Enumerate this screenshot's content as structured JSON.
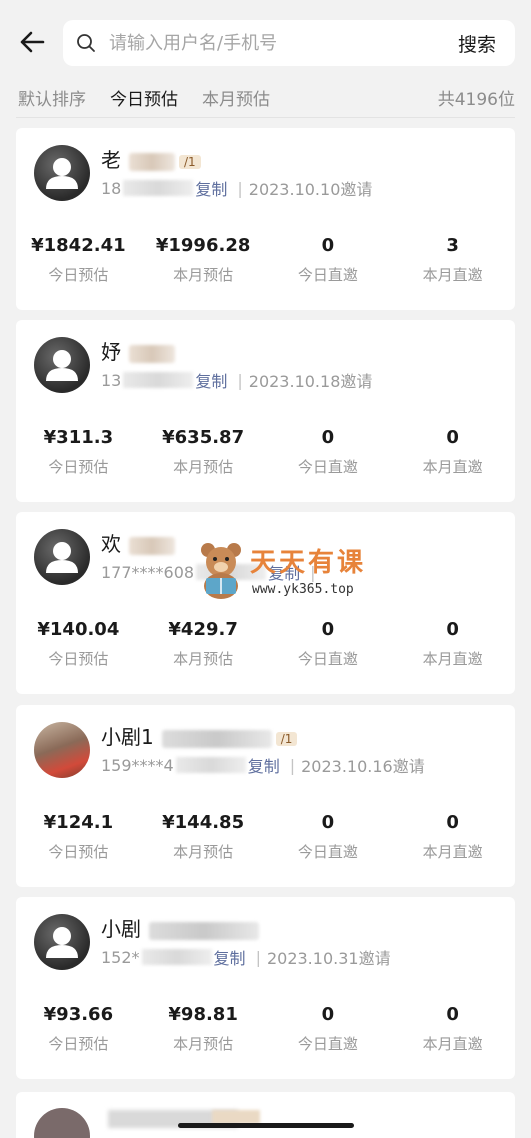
{
  "header": {
    "back_icon": "arrow-left-icon",
    "search_icon": "search-icon",
    "search_placeholder": "请输入用户名/手机号",
    "search_button": "搜索"
  },
  "sort": {
    "tabs": [
      "默认排序",
      "今日预估",
      "本月预估"
    ],
    "active_index": 1,
    "total": "共4196位"
  },
  "stat_labels": [
    "今日预估",
    "本月预估",
    "今日直邀",
    "本月直邀"
  ],
  "copy_label": "复制",
  "separator": "|",
  "members": [
    {
      "name": "老",
      "tag": "/1",
      "phone_prefix": "18",
      "phone_suffix": "",
      "invite": "2023.10.10邀请",
      "today_est": "¥1842.41",
      "month_est": "¥1996.28",
      "today_invites": "0",
      "month_invites": "3"
    },
    {
      "name": "妤",
      "tag": "",
      "phone_prefix": "13",
      "phone_suffix": "",
      "invite": "2023.10.18邀请",
      "today_est": "¥311.3",
      "month_est": "¥635.87",
      "today_invites": "0",
      "month_invites": "0"
    },
    {
      "name": "欢",
      "tag": "",
      "phone_prefix": "177****608",
      "phone_suffix": "",
      "invite": "",
      "today_est": "¥140.04",
      "month_est": "¥429.7",
      "today_invites": "0",
      "month_invites": "0"
    },
    {
      "name": "小剧1",
      "tag": "/1",
      "phone_prefix": "159****4",
      "phone_suffix": "",
      "invite": "2023.10.16邀请",
      "today_est": "¥124.1",
      "month_est": "¥144.85",
      "today_invites": "0",
      "month_invites": "0"
    },
    {
      "name": "小剧",
      "tag": "",
      "phone_prefix": "152*",
      "phone_suffix": "",
      "invite": "2023.10.31邀请",
      "today_est": "¥93.66",
      "month_est": "¥98.81",
      "today_invites": "0",
      "month_invites": "0"
    }
  ],
  "watermark": {
    "title": "天天有课",
    "url": "www.yk365.top"
  },
  "colors": {
    "background": "#f2f2f2",
    "card": "#ffffff",
    "copy_link": "#5f6f9e",
    "watermark": "#e7833a"
  }
}
